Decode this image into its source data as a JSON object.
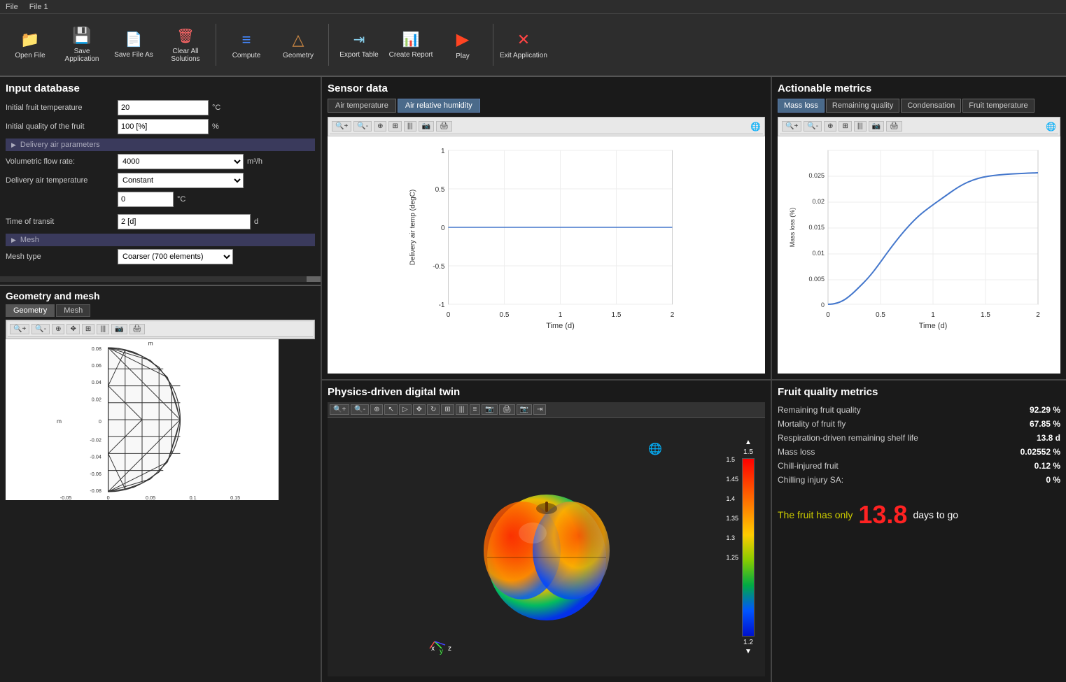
{
  "titlebar": {
    "items": [
      "File",
      "File 1"
    ]
  },
  "toolbar": {
    "buttons": [
      {
        "id": "open-file",
        "label": "Open File",
        "icon": "folder"
      },
      {
        "id": "save-application",
        "label": "Save Application",
        "icon": "save"
      },
      {
        "id": "save-file-as",
        "label": "Save File As",
        "icon": "saveas"
      },
      {
        "id": "clear-solutions",
        "label": "Clear All Solutions",
        "icon": "clear"
      },
      {
        "id": "compute",
        "label": "Compute",
        "icon": "compute"
      },
      {
        "id": "geometry",
        "label": "Geometry",
        "icon": "geometry"
      },
      {
        "id": "export-table",
        "label": "Export Table",
        "icon": "export"
      },
      {
        "id": "create-report",
        "label": "Create Report",
        "icon": "report"
      },
      {
        "id": "play",
        "label": "Play",
        "icon": "play"
      },
      {
        "id": "exit-application",
        "label": "Exit Application",
        "icon": "exit"
      }
    ]
  },
  "input_database": {
    "title": "Input database",
    "fields": [
      {
        "label": "Initial fruit temperature",
        "value": "20",
        "unit": "°C"
      },
      {
        "label": "Initial quality of the fruit",
        "value": "100 [%]",
        "unit": "%"
      }
    ],
    "delivery_air": {
      "header": "Delivery air parameters",
      "volumetric_flow_rate_label": "Volumetric flow rate:",
      "volumetric_flow_rate_value": "4000",
      "volumetric_flow_rate_unit": "m³/h",
      "delivery_air_temp_label": "Delivery air temperature",
      "delivery_air_temp_value": "Constant",
      "temp_value": "0",
      "temp_unit": "°C"
    },
    "transit": {
      "label": "Time of transit",
      "value": "2 [d]",
      "unit": "d"
    },
    "mesh": {
      "header": "Mesh",
      "mesh_type_label": "Mesh type",
      "mesh_type_value": "Coarser (700 elements)"
    }
  },
  "geo_mesh": {
    "title": "Geometry and mesh",
    "tabs": [
      "Geometry",
      "Mesh"
    ],
    "active_tab": "Geometry",
    "y_axis_values": [
      "0.08",
      "0.06",
      "0.04",
      "0.02",
      "0",
      "-0.02",
      "-0.04",
      "-0.06",
      "-0.08"
    ],
    "x_axis_values": [
      "-0.05",
      "0",
      "0.05",
      "0.1",
      "0.15"
    ],
    "axis_labels": {
      "x": "m",
      "y": "m"
    }
  },
  "sensor_data": {
    "title": "Sensor data",
    "tabs": [
      "Air temperature",
      "Air relative humidity"
    ],
    "active_tab": "Air relative humidity",
    "chart": {
      "x_label": "Time (d)",
      "y_label": "Delivery air temp (degC)",
      "x_min": 0,
      "x_max": 2,
      "y_min": -1,
      "y_max": 1,
      "x_ticks": [
        0,
        0.5,
        1,
        1.5,
        2
      ],
      "y_ticks": [
        -1,
        -0.5,
        0,
        0.5,
        1
      ]
    }
  },
  "actionable_metrics": {
    "title": "Actionable metrics",
    "tabs": [
      "Mass loss",
      "Remaining quality",
      "Condensation",
      "Fruit temperature"
    ],
    "active_tab": "Mass loss",
    "chart": {
      "x_label": "Time (d)",
      "y_label": "Mass loss (%)",
      "x_min": 0,
      "x_max": 2,
      "y_min": 0,
      "y_max": 0.03,
      "x_ticks": [
        0,
        0.5,
        1,
        1.5,
        2
      ],
      "y_ticks": [
        0,
        0.005,
        0.01,
        0.015,
        0.02,
        0.025
      ]
    }
  },
  "physics_twin": {
    "title": "Physics-driven digital twin",
    "colorbar": {
      "max": "1.5",
      "values": [
        "1.5",
        "1.45",
        "1.4",
        "1.35",
        "1.3",
        "1.25"
      ],
      "min": "1.2",
      "triangle_up": "▲",
      "triangle_down": "▼"
    }
  },
  "fruit_quality": {
    "title": "Fruit quality metrics",
    "metrics": [
      {
        "label": "Remaining fruit quality",
        "value": "92.29 %"
      },
      {
        "label": "Mortality of fruit fly",
        "value": "67.85 %"
      },
      {
        "label": "Respiration-driven remaining shelf life",
        "value": "13.8 d"
      },
      {
        "label": "Mass loss",
        "value": "0.02552 %"
      },
      {
        "label": "Chill-injured fruit",
        "value": "0.12 %"
      },
      {
        "label": "Chilling injury SA:",
        "value": "0 %"
      }
    ],
    "message": {
      "prefix": "The fruit has only",
      "number": "13.8",
      "suffix": "days to go"
    }
  }
}
